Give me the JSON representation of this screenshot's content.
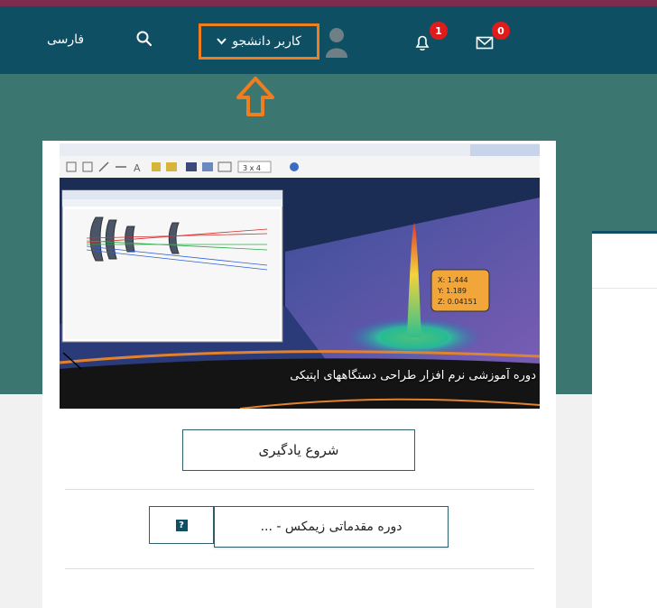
{
  "header": {
    "language_label": "فارسی",
    "user_label": "کاربر دانشجو",
    "notifications_count": "1",
    "messages_count": "0",
    "colors": {
      "bar": "#0f4f63",
      "accent": "#f07d1e",
      "badge": "#e11b1b"
    }
  },
  "course_card": {
    "image_caption": "دوره آموزشی نرم افزار طراحی دستگاههای اپتیکی",
    "image_tooltip": {
      "x": "X: 1.444",
      "y": "Y: 1.189",
      "z": "Z: 0.04151"
    },
    "toolbar_zoom": "3 x 4",
    "start_button": "شروع یادگیری",
    "course_button": "دوره مقدماتی زیمکس - ...",
    "help_icon_glyph": "?"
  }
}
